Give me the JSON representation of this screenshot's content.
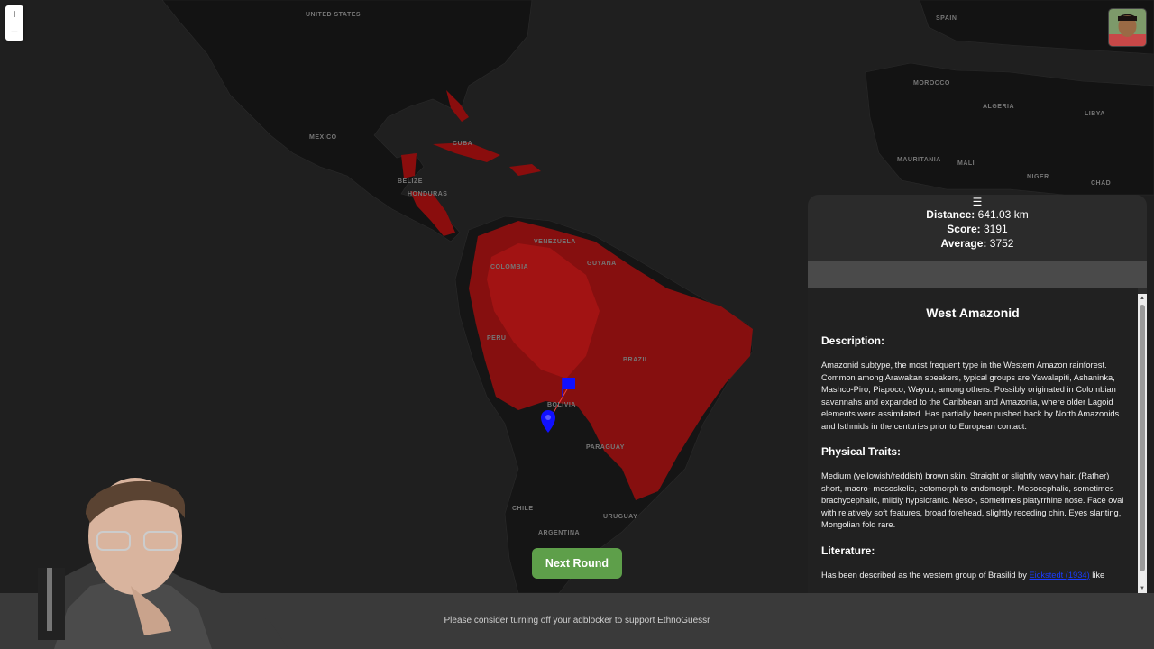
{
  "map": {
    "labels": [
      "UNITED STATES",
      "MEXICO",
      "BELIZE",
      "HONDURAS",
      "CUBA",
      "VENEZUELA",
      "GUYANA",
      "COLOMBIA",
      "PERU",
      "BRAZIL",
      "BOLIVIA",
      "PARAGUAY",
      "CHILE",
      "URUGUAY",
      "ARGENTINA",
      "SPAIN",
      "MOROCCO",
      "ALGERIA",
      "LIBYA",
      "MAURITANIA",
      "MALI",
      "NIGER",
      "CHAD"
    ],
    "zoom_in": "+",
    "zoom_out": "−"
  },
  "stats": {
    "distance_label": "Distance:",
    "distance_value": "641.03 km",
    "score_label": "Score:",
    "score_value": "3191",
    "average_label": "Average:",
    "average_value": "3752"
  },
  "panel": {
    "handle": "☰",
    "title": "West Amazonid",
    "description_heading": "Description:",
    "description": "Amazonid subtype, the most frequent type in the Western Amazon rainforest. Common among Arawakan speakers, typical groups are Yawalapiti, Ashaninka, Mashco-Piro, Piapoco, Wayuu, among others. Possibly originated in Colombian savannahs and expanded to the Caribbean and Amazonia, where older Lagoid elements were assimilated. Has partially been pushed back by North Amazonids and Isthmids in the centuries prior to European contact.",
    "traits_heading": "Physical Traits:",
    "traits": "Medium (yellowish/reddish) brown skin. Straight or slightly wavy hair. (Rather) short, macro- mesoskelic, ectomorph to endomorph. Mesocephalic, sometimes brachycephalic, mildly hypsicranic. Meso-, sometimes platyrrhine nose. Face oval with relatively soft features, broad forehead, slightly receding chin. Eyes slanting, Mongolian fold rare.",
    "literature_heading": "Literature:",
    "literature_prefix": "Has been described as the western group of Brasilid by ",
    "literature_link": "Eickstedt (1934)",
    "literature_suffix": " like"
  },
  "next_button": "Next Round",
  "footer": "Please consider turning off your adblocker to support EthnoGuessr",
  "colors": {
    "map_bg": "#1c1c1c",
    "land": "#121212",
    "highlight": "#8a0d0d",
    "highlight_light": "#a31212",
    "marker": "#1010ff",
    "button": "#5e9f4a"
  }
}
